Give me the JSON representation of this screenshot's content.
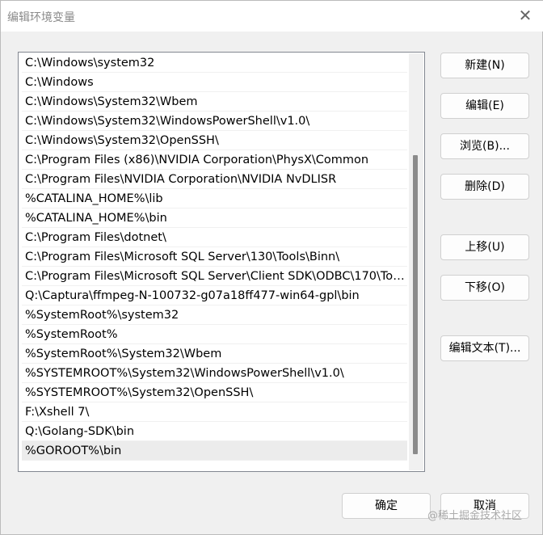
{
  "title": "编辑环境变量",
  "paths": [
    "C:\\Windows\\system32",
    "C:\\Windows",
    "C:\\Windows\\System32\\Wbem",
    "C:\\Windows\\System32\\WindowsPowerShell\\v1.0\\",
    "C:\\Windows\\System32\\OpenSSH\\",
    "C:\\Program Files (x86)\\NVIDIA Corporation\\PhysX\\Common",
    "C:\\Program Files\\NVIDIA Corporation\\NVIDIA NvDLISR",
    "%CATALINA_HOME%\\lib",
    "%CATALINA_HOME%\\bin",
    "C:\\Program Files\\dotnet\\",
    "C:\\Program Files\\Microsoft SQL Server\\130\\Tools\\Binn\\",
    "C:\\Program Files\\Microsoft SQL Server\\Client SDK\\ODBC\\170\\Tools\\Binn\\",
    "Q:\\Captura\\ffmpeg-N-100732-g07a18ff477-win64-gpl\\bin",
    "%SystemRoot%\\system32",
    "%SystemRoot%",
    "%SystemRoot%\\System32\\Wbem",
    "%SYSTEMROOT%\\System32\\WindowsPowerShell\\v1.0\\",
    "%SYSTEMROOT%\\System32\\OpenSSH\\",
    "F:\\Xshell 7\\",
    "Q:\\Golang-SDK\\bin",
    "%GOROOT%\\bin"
  ],
  "buttons": {
    "new": "新建(N)",
    "edit": "编辑(E)",
    "browse": "浏览(B)...",
    "delete": "删除(D)",
    "up": "上移(U)",
    "down": "下移(O)",
    "edit_text": "编辑文本(T)...",
    "ok": "确定",
    "cancel": "取消"
  },
  "watermark": "@稀土掘金技术社区"
}
